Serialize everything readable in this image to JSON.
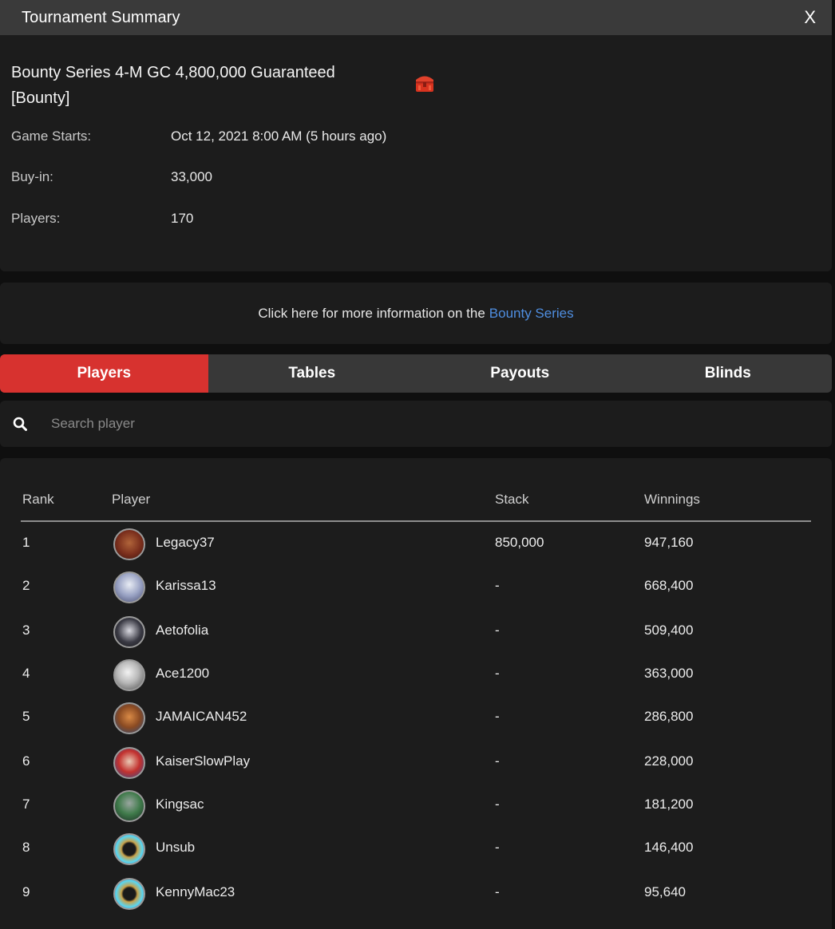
{
  "window": {
    "title": "Tournament Summary",
    "close_label": "X"
  },
  "tournament": {
    "name": "Bounty Series 4-M GC 4,800,000 Guaranteed [Bounty]",
    "icon": "treasure-chest-icon",
    "game_starts_label": "Game Starts:",
    "game_starts_value": "Oct 12, 2021 8:00 AM (5 hours ago)",
    "buyin_label": "Buy-in:",
    "buyin_value": "33,000",
    "players_label": "Players:",
    "players_value": "170"
  },
  "banner": {
    "text": "Click here for more information on the",
    "link": "Bounty Series"
  },
  "tabs": [
    {
      "label": "Players",
      "active": true
    },
    {
      "label": "Tables",
      "active": false
    },
    {
      "label": "Payouts",
      "active": false
    },
    {
      "label": "Blinds",
      "active": false
    }
  ],
  "search": {
    "placeholder": "Search player",
    "icon": "search-icon"
  },
  "table": {
    "headers": {
      "rank": "Rank",
      "player": "Player",
      "stack": "Stack",
      "winnings": "Winnings"
    },
    "rows": [
      {
        "rank": "1",
        "player": "Legacy37",
        "stack": "850,000",
        "winnings": "947,160"
      },
      {
        "rank": "2",
        "player": "Karissa13",
        "stack": "-",
        "winnings": "668,400"
      },
      {
        "rank": "3",
        "player": "Aetofolia",
        "stack": "-",
        "winnings": "509,400"
      },
      {
        "rank": "4",
        "player": "Ace1200",
        "stack": "-",
        "winnings": "363,000"
      },
      {
        "rank": "5",
        "player": "JAMAICAN452",
        "stack": "-",
        "winnings": "286,800"
      },
      {
        "rank": "6",
        "player": "KaiserSlowPlay",
        "stack": "-",
        "winnings": "228,000"
      },
      {
        "rank": "7",
        "player": "Kingsac",
        "stack": "-",
        "winnings": "181,200"
      },
      {
        "rank": "8",
        "player": "Unsub",
        "stack": "-",
        "winnings": "146,400"
      },
      {
        "rank": "9",
        "player": "KennyMac23",
        "stack": "-",
        "winnings": "95,640"
      }
    ]
  },
  "colors": {
    "accent": "#d7322f",
    "link": "#4f8ee0"
  }
}
